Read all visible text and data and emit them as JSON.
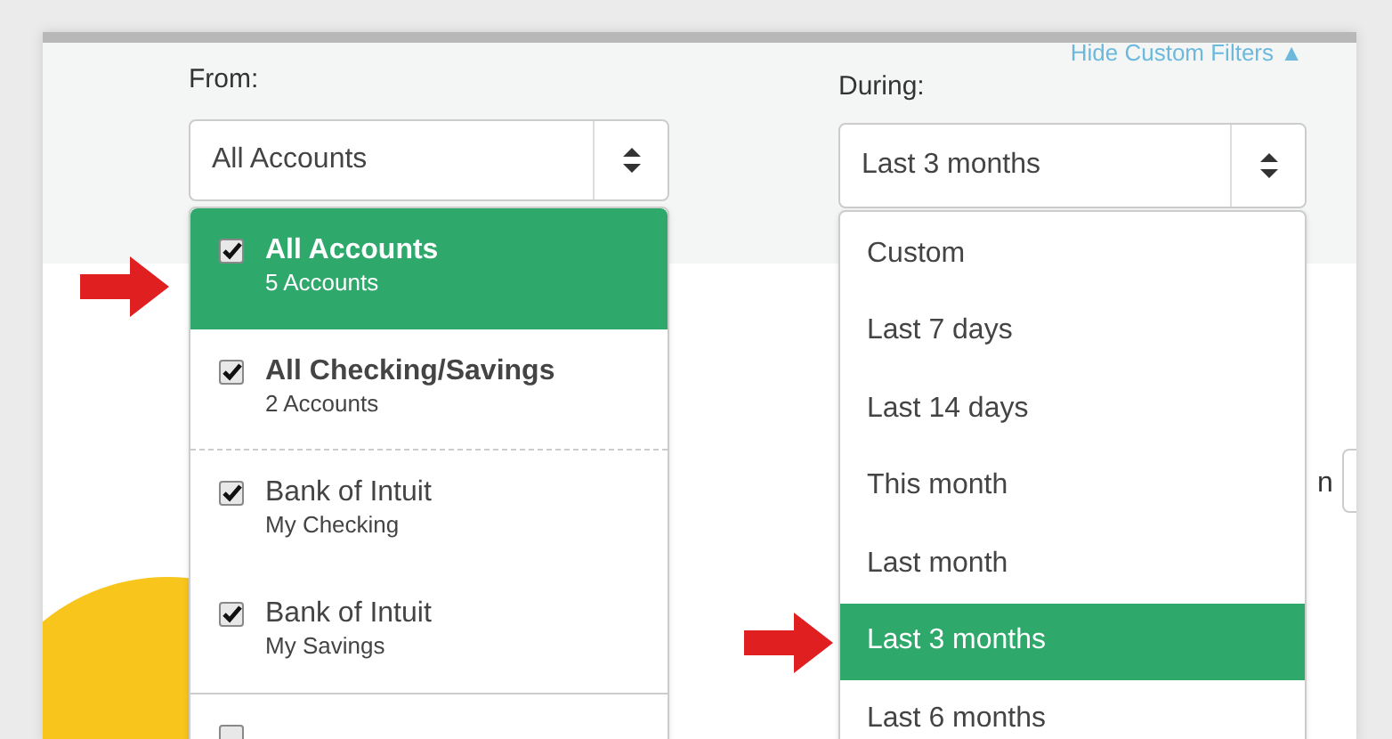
{
  "filters_link": {
    "label": "Hide Custom Filters",
    "icon": "▲"
  },
  "from": {
    "label": "From:",
    "value": "All Accounts"
  },
  "during": {
    "label": "During:",
    "value": "Last 3 months"
  },
  "accounts": [
    {
      "name": "All Accounts",
      "detail": "5 Accounts",
      "checked": true,
      "selected": true,
      "bold": true
    },
    {
      "name": "All Checking/Savings",
      "detail": "2 Accounts",
      "checked": true,
      "selected": false,
      "bold": true
    },
    {
      "name": "Bank of Intuit",
      "detail": "My Checking",
      "checked": true,
      "selected": false,
      "bold": false
    },
    {
      "name": "Bank of Intuit",
      "detail": "My Savings",
      "checked": true,
      "selected": false,
      "bold": false
    }
  ],
  "periods": [
    {
      "label": "Custom",
      "selected": false
    },
    {
      "label": "Last 7 days",
      "selected": false
    },
    {
      "label": "Last 14 days",
      "selected": false
    },
    {
      "label": "This month",
      "selected": false
    },
    {
      "label": "Last month",
      "selected": false
    },
    {
      "label": "Last 3 months",
      "selected": true
    },
    {
      "label": "Last 6 months",
      "selected": false
    }
  ],
  "next_account_checkbox": {
    "checked": false
  },
  "background_text": "n"
}
